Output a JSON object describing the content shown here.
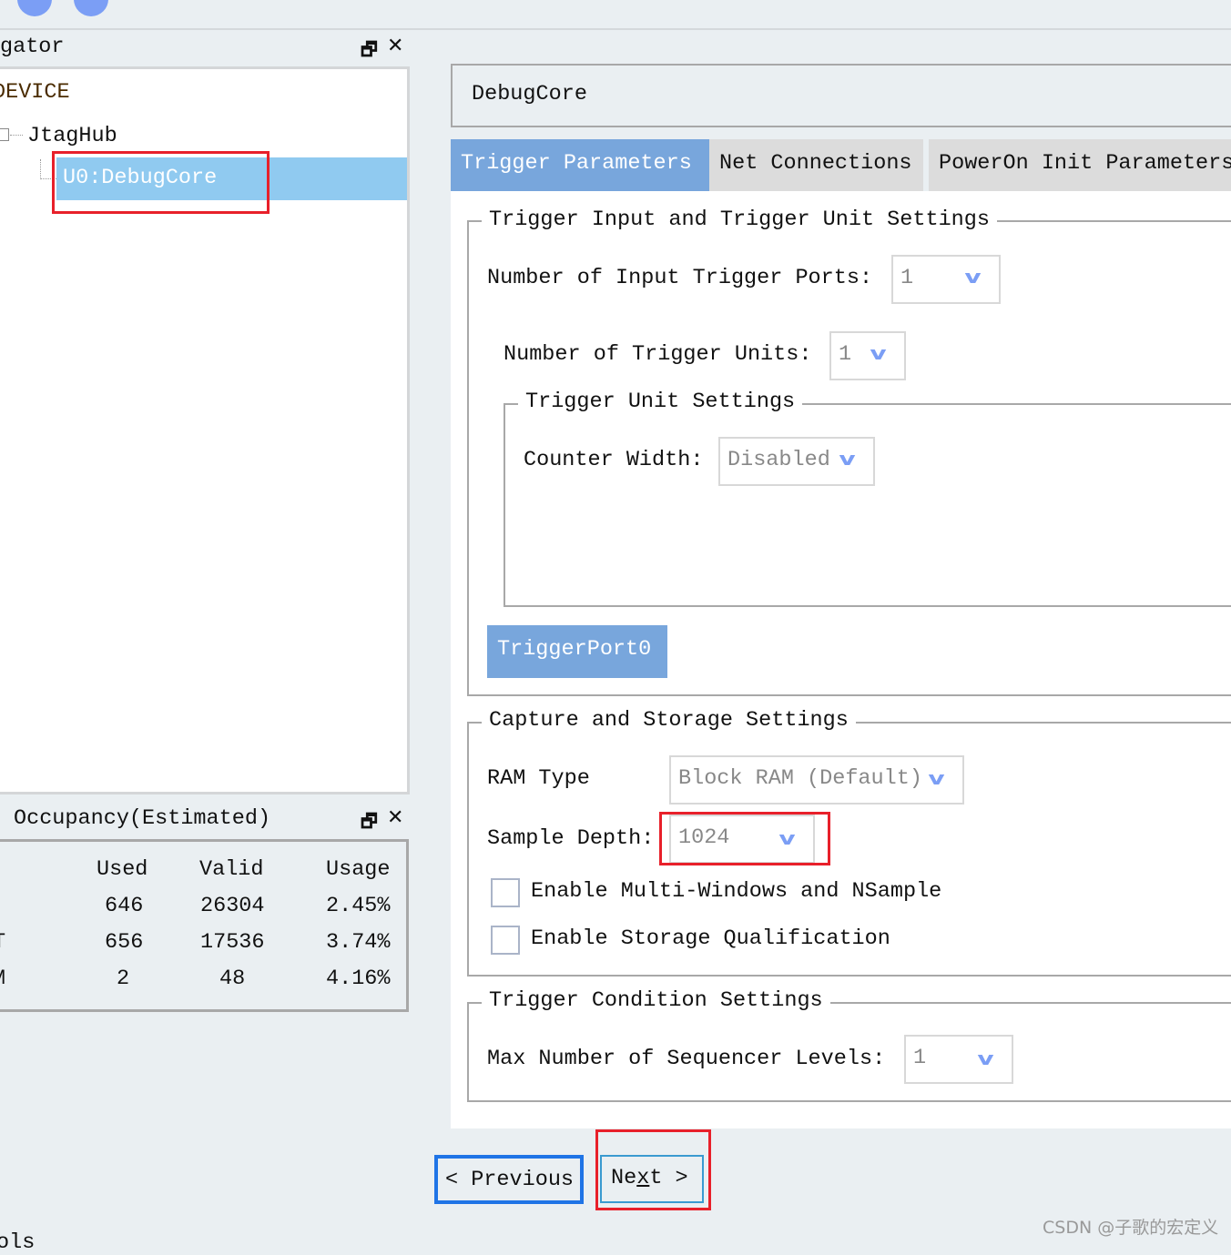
{
  "navigator": {
    "title": "gator",
    "tree": {
      "root": "DEVICE",
      "hub": "JtagHub",
      "core": "U0:DebugCore"
    }
  },
  "occupancy": {
    "title": "Occupancy(Estimated)",
    "columns": [
      "Used",
      "Valid",
      "Usage"
    ],
    "rows": [
      {
        "label": "",
        "used": "646",
        "valid": "26304",
        "usage": "2.45%"
      },
      {
        "label": "T",
        "used": "656",
        "valid": "17536",
        "usage": "3.74%"
      },
      {
        "label": "M",
        "used": "2",
        "valid": "48",
        "usage": "4.16%"
      }
    ]
  },
  "bottom_text": "ols",
  "core_name": "DebugCore",
  "tabs": [
    {
      "label": "Trigger Parameters",
      "active": true
    },
    {
      "label": "Net Connections"
    },
    {
      "label": "PowerOn Init Parameters"
    }
  ],
  "trigger_group": {
    "title": "Trigger Input and Trigger Unit Settings",
    "ports_label": "Number of Input Trigger Ports:",
    "ports_value": "1",
    "units_label": "Number of Trigger Units:",
    "units_value": "1",
    "unit_settings": {
      "title": "Trigger Unit Settings",
      "counter_label": "Counter Width:",
      "counter_value": "Disabled"
    },
    "port_button": "TriggerPort0"
  },
  "capture_group": {
    "title": "Capture and Storage Settings",
    "ram_label": "RAM Type",
    "ram_value": "Block RAM (Default)",
    "depth_label": "Sample Depth:",
    "depth_value": "1024",
    "multi_windows": {
      "label": "Enable Multi-Windows and NSample",
      "checked": false
    },
    "storage_qual": {
      "label": "Enable Storage Qualification",
      "checked": false
    }
  },
  "condition_group": {
    "title": "Trigger Condition Settings",
    "levels_label": "Max Number of Sequencer Levels:",
    "levels_value": "1"
  },
  "buttons": {
    "previous": "< Previous",
    "next_pre": "Ne",
    "next_u": "x",
    "next_post": "t >"
  },
  "watermark": "CSDN @子歌的宏定义",
  "colors": {
    "active_tab": "#78a6dc",
    "selection": "#90caf0",
    "highlight_red": "#e8202a",
    "highlight_blue": "#1f74e6",
    "chevron": "#7b9ef5"
  }
}
